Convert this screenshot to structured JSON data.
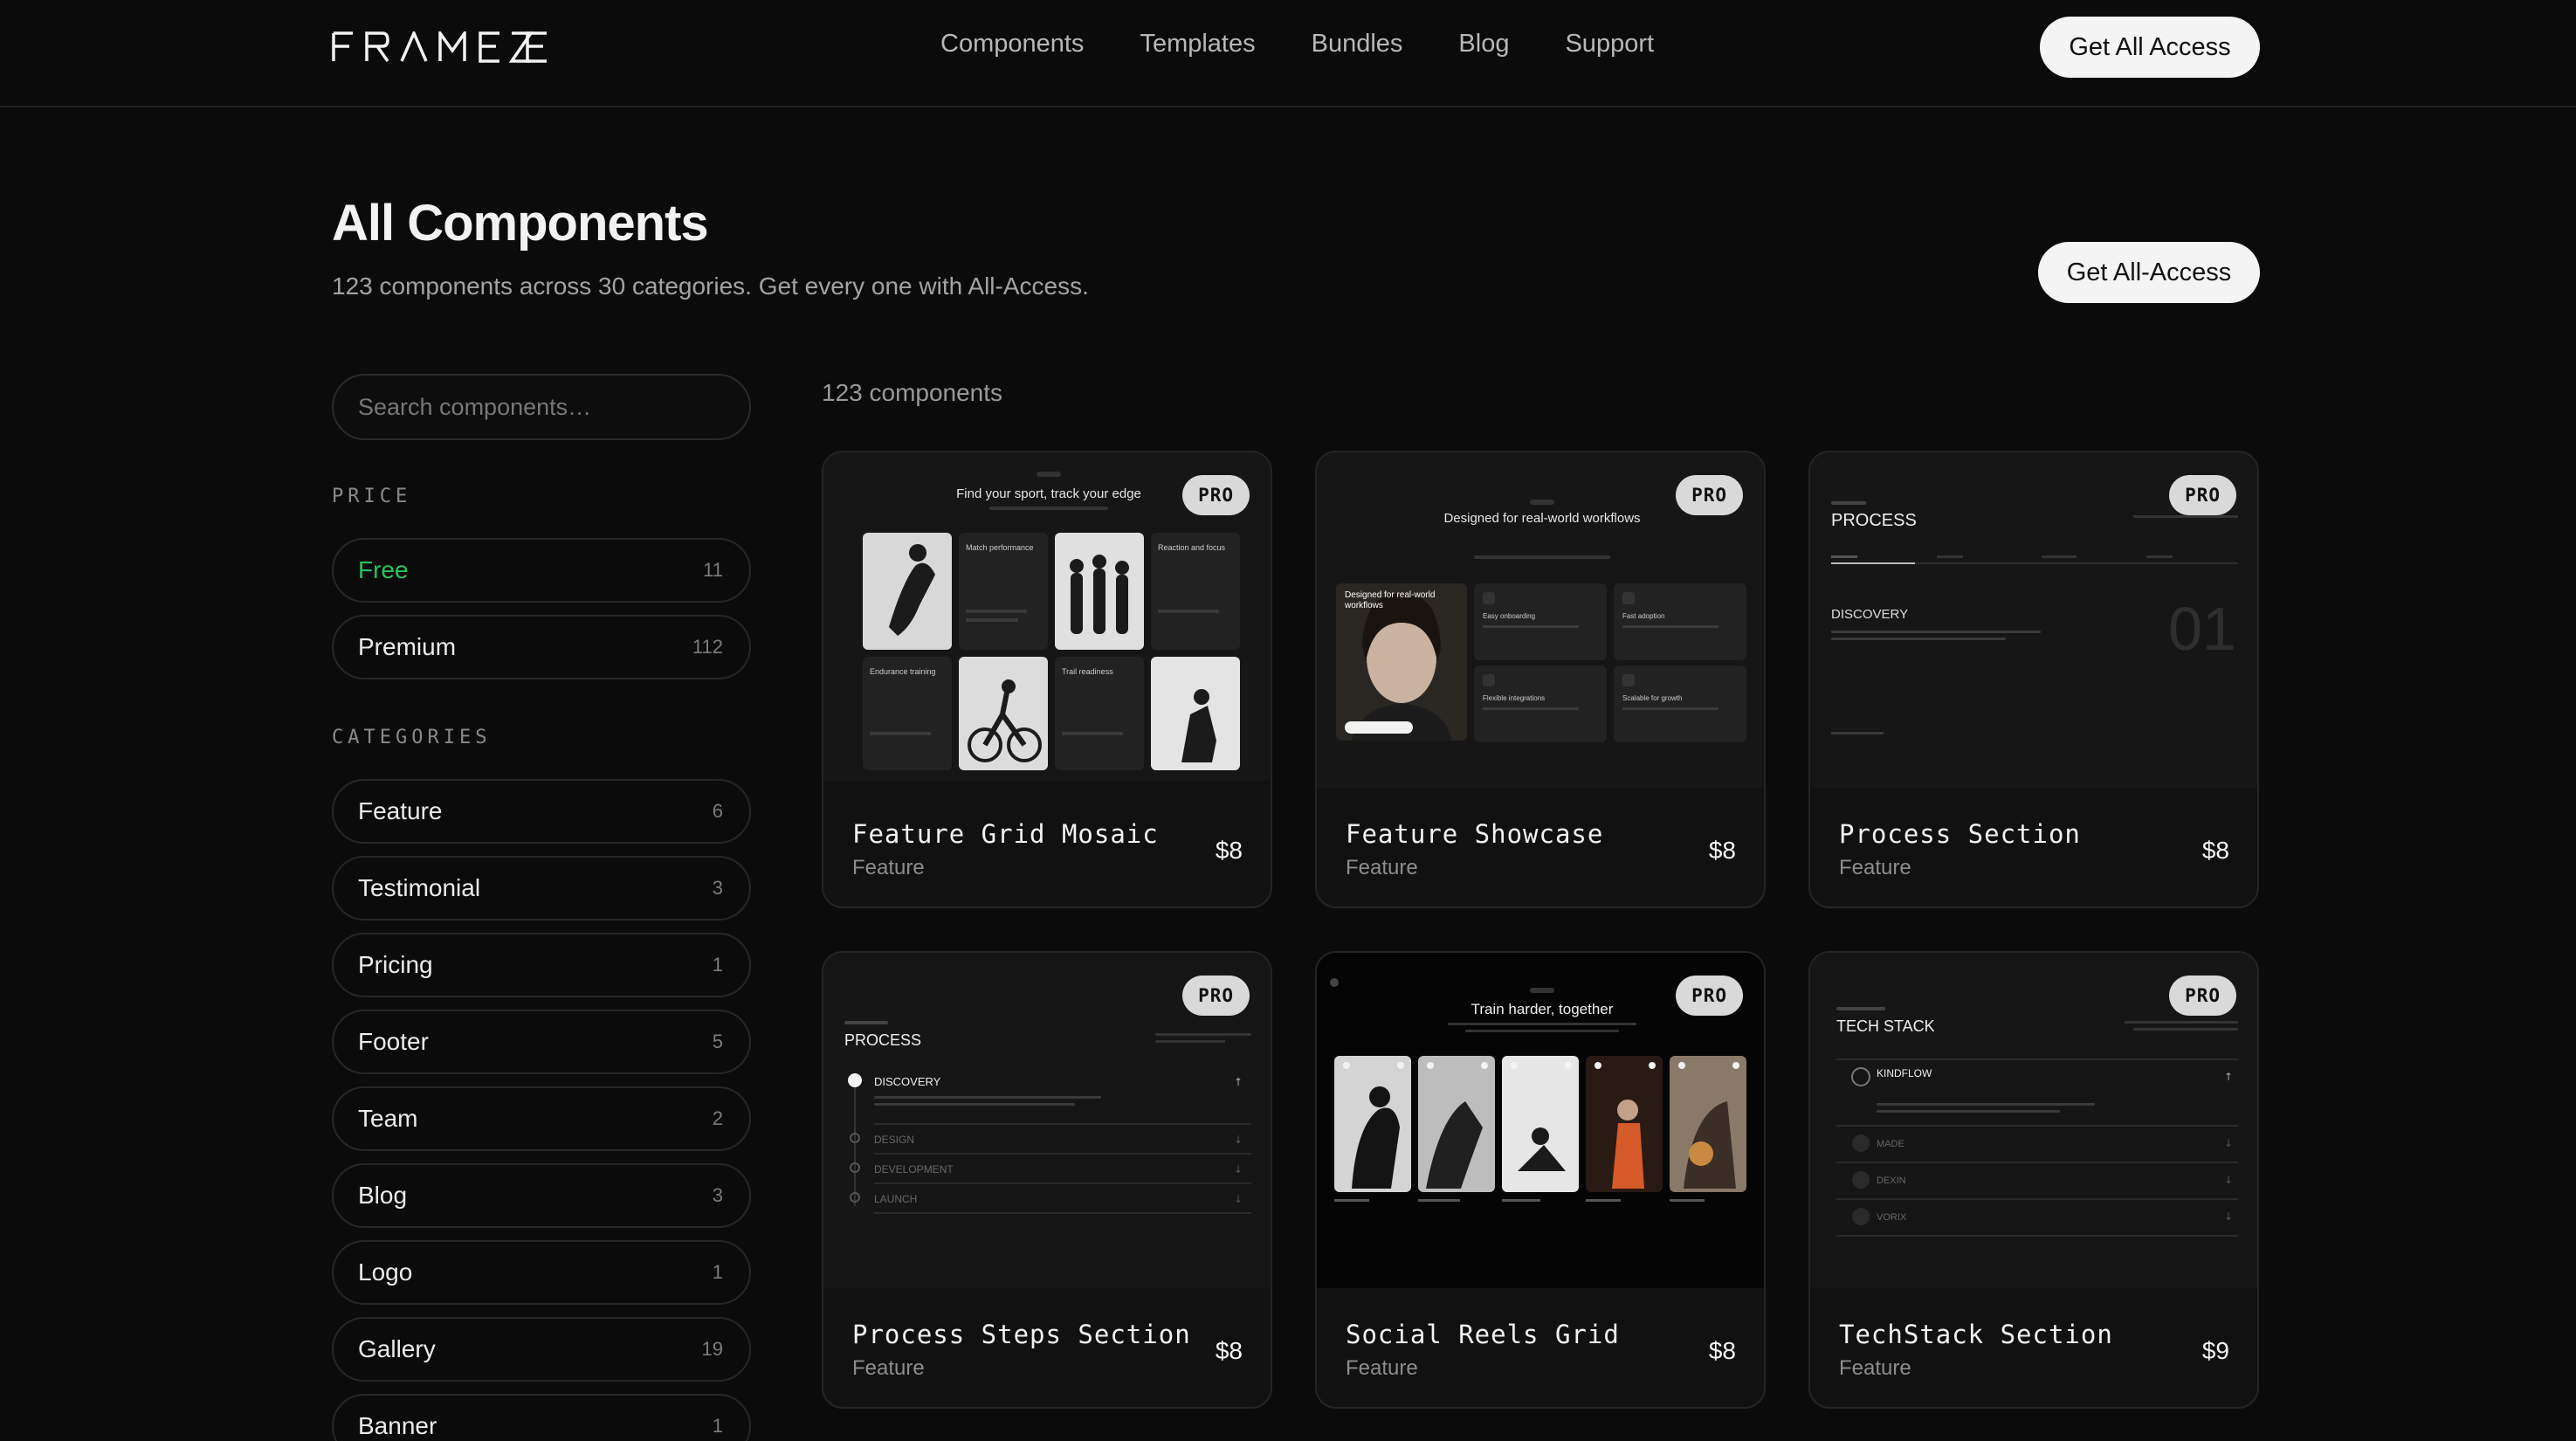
{
  "nav": {
    "logo": "FRAMEZE",
    "links": [
      "Components",
      "Templates",
      "Bundles",
      "Blog",
      "Support"
    ],
    "cta": "Get All Access"
  },
  "header": {
    "title": "All Components",
    "subtitle": "123 components across 30 categories. Get every one with All-Access.",
    "cta": "Get All-Access"
  },
  "sidebar": {
    "search_placeholder": "Search components…",
    "price_heading": "PRICE",
    "price": [
      {
        "label": "Free",
        "count": "11",
        "active": true
      },
      {
        "label": "Premium",
        "count": "112"
      }
    ],
    "categories_heading": "CATEGORIES",
    "categories": [
      {
        "label": "Feature",
        "count": "6"
      },
      {
        "label": "Testimonial",
        "count": "3"
      },
      {
        "label": "Pricing",
        "count": "1"
      },
      {
        "label": "Footer",
        "count": "5"
      },
      {
        "label": "Team",
        "count": "2"
      },
      {
        "label": "Blog",
        "count": "3"
      },
      {
        "label": "Logo",
        "count": "1"
      },
      {
        "label": "Gallery",
        "count": "19"
      },
      {
        "label": "Banner",
        "count": "1"
      }
    ]
  },
  "results": {
    "count_label": "123 components",
    "cards": [
      {
        "name": "Feature Grid Mosaic",
        "category": "Feature",
        "price": "$8",
        "badge": "PRO",
        "preview": {
          "title": "Find your sport, track your edge",
          "items": [
            "Match performance",
            "Reaction and focus",
            "Endurance training",
            "Trail readiness"
          ]
        }
      },
      {
        "name": "Feature Showcase",
        "category": "Feature",
        "price": "$8",
        "badge": "PRO",
        "preview": {
          "title": "Designed for real-world workflows",
          "items": [
            "Designed for real-world workflows",
            "Easy onboarding",
            "Fast adoption",
            "Flexible integrations",
            "Scalable for growth"
          ]
        }
      },
      {
        "name": "Process Section",
        "category": "Feature",
        "price": "$8",
        "badge": "PRO",
        "preview": {
          "title": "PROCESS",
          "items": [
            "DISCOVERY",
            "01"
          ]
        }
      },
      {
        "name": "Process Steps Section",
        "category": "Feature",
        "price": "$8",
        "badge": "PRO",
        "preview": {
          "title": "PROCESS",
          "items": [
            "DISCOVERY",
            "DESIGN",
            "DEVELOPMENT",
            "LAUNCH"
          ]
        }
      },
      {
        "name": "Social Reels Grid",
        "category": "Feature",
        "price": "$8",
        "badge": "PRO",
        "preview": {
          "title": "Train harder, together",
          "items": []
        }
      },
      {
        "name": "TechStack Section",
        "category": "Feature",
        "price": "$9",
        "badge": "PRO",
        "preview": {
          "title": "TECH STACK",
          "items": [
            "KINDFLOW",
            "MADE",
            "DEXIN",
            "VORIX"
          ]
        }
      }
    ]
  }
}
